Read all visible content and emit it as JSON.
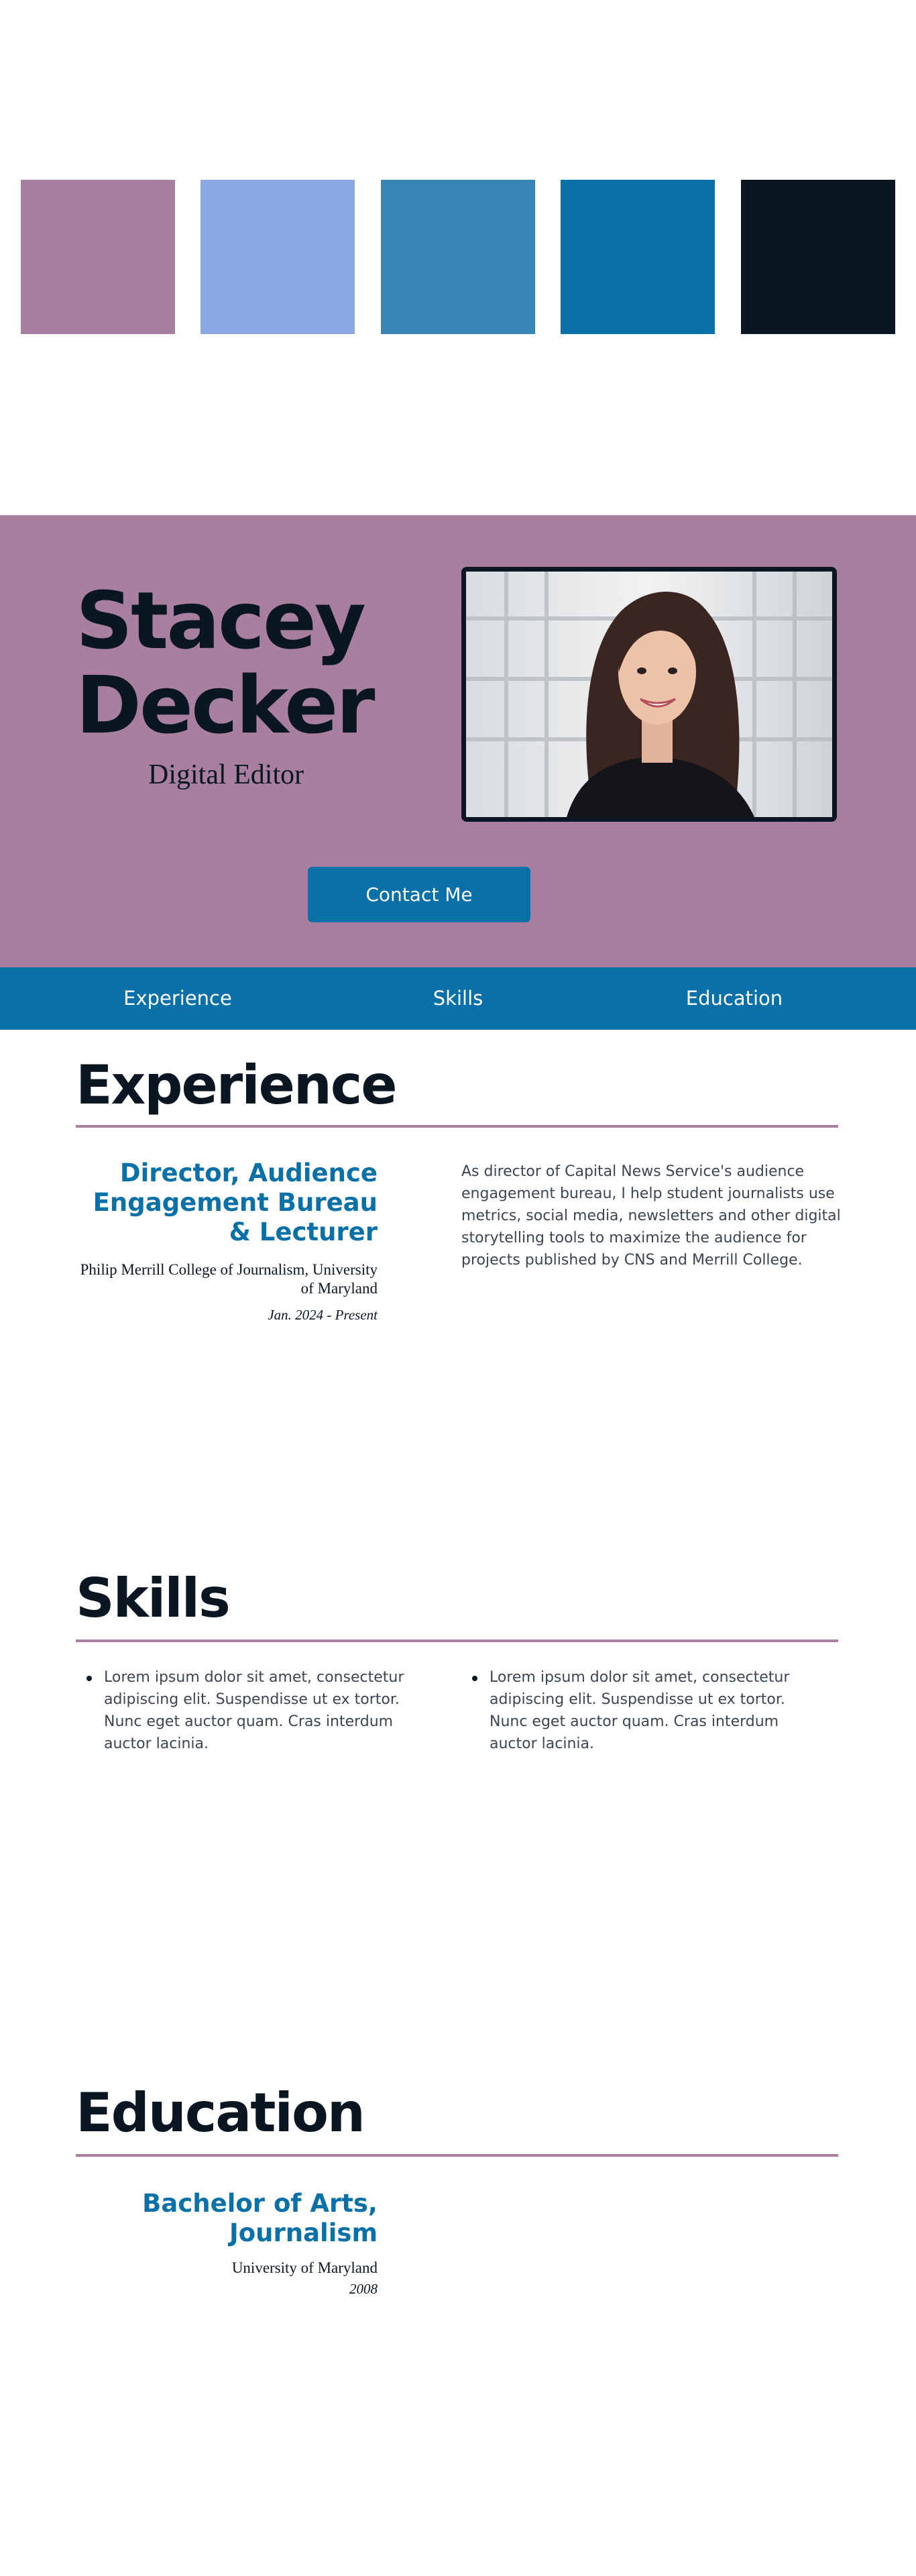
{
  "palette": {
    "colors": [
      "#a97f9f",
      "#8ba8e3",
      "#3685b5",
      "#0a70a8",
      "#0a1723"
    ]
  },
  "hero": {
    "first_name": "Stacey",
    "last_name": "Decker",
    "role": "Digital Editor",
    "contact_label": "Contact Me",
    "background": "#a97f9f"
  },
  "nav": {
    "items": [
      {
        "label": "Experience"
      },
      {
        "label": "Skills"
      },
      {
        "label": "Education"
      }
    ]
  },
  "experience": {
    "heading": "Experience",
    "entries": [
      {
        "title": "Director, Audience Engagement Bureau & Lecturer",
        "organization": "Philip Merrill College of Journalism, University of Maryland",
        "dates": "Jan. 2024 - Present",
        "description": "As director of Capital News Service's audience engagement bureau, I help student journalists use metrics, social media, newsletters and other digital storytelling tools to maximize the audience for projects published by CNS and Merrill College."
      }
    ]
  },
  "skills": {
    "heading": "Skills",
    "items": [
      "Lorem ipsum dolor sit amet, consectetur adipiscing elit. Suspendisse ut ex tortor. Nunc eget auctor quam. Cras interdum auctor lacinia.",
      "Lorem ipsum dolor sit amet, consectetur adipiscing elit. Suspendisse ut ex tortor. Nunc eget auctor quam. Cras interdum auctor lacinia."
    ]
  },
  "education": {
    "heading": "Education",
    "entries": [
      {
        "degree": "Bachelor of Arts, Journalism",
        "school": "University of Maryland",
        "year": "2008"
      }
    ]
  },
  "colors": {
    "accent": "#0a70a8",
    "dark": "#0a1723",
    "mauve": "#a97f9f"
  }
}
